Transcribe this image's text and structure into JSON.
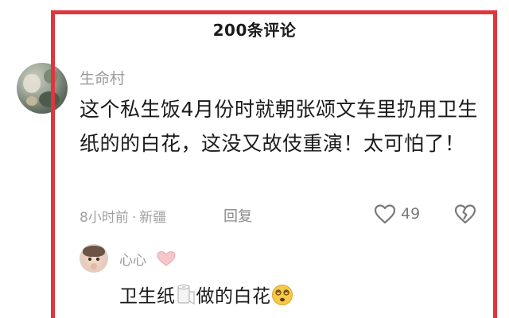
{
  "header": {
    "title": "200条评论"
  },
  "comment": {
    "username": "生命村",
    "text": "这个私生饭4月份时就朝张颂文车里扔用卫生纸的的白花，这没又故伎重演！太可怕了！",
    "time": "8小时前",
    "location": "新疆",
    "meta_separator": "·",
    "reply_label": "回复",
    "likes": "49"
  },
  "reply": {
    "username": "心心",
    "text_part1": "卫生纸",
    "text_part2": "做的白花"
  },
  "icons": {
    "like": "heart-outline-icon",
    "dislike": "broken-heart-icon",
    "username_badge": "pink-heart-icon",
    "toilet_paper": "toilet-paper-emoji",
    "dizzy_face": "dizzy-face-emoji"
  },
  "colors": {
    "frame": "#e0353d",
    "username": "#9a9a9a",
    "meta": "#a0a0a0",
    "text": "#1a1a1a",
    "heart_badge": "#f6c7c9"
  }
}
